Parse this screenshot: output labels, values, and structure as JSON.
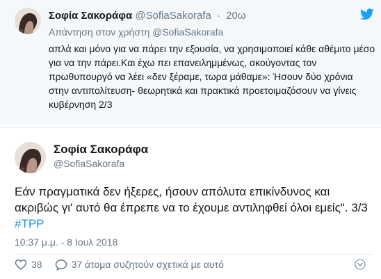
{
  "reply_tweet": {
    "name": "Σοφία Σακοράφα",
    "handle": "@SofiaSakorafa",
    "time": "20ω",
    "replying_prefix": "Απάντηση στον χρήστη",
    "replying_handle": "@SofiaSakorafa",
    "text": "απλά και μόνο για να πάρει την εξουσία, να χρησιμοποιεί κάθε αθέμιτο μέσο για να την πάρει.Και έχω πει επανειλημμένως, ακούγοντας τον πρωθυπουργό να λέει «δεν ξέραμε, τωρα μάθαμε»: Ήσουν δύο χρόνια στην αντιπολίτευση- θεωρητικά και πρακτικά προετοιμαζόσουν να γίνεις κυβέρνηση 2/3"
  },
  "main_tweet": {
    "name": "Σοφία Σακοράφα",
    "handle": "@SofiaSakorafa",
    "text": "Εάν πραγματικά δεν ήξερες, ήσουν απόλυτα επικίνδυνος και ακριβώς γι' αυτό θα έπρεπε να το έχουμε αντιληφθεί όλοι εμείς\". 3/3",
    "hashtag": "#TPP",
    "timestamp": "10:37 μ.μ. - 8 Ιουλ 2018",
    "like_count": "38",
    "reply_label": "37 άτομα συζητούν σχετικά με αυτό"
  },
  "icons": {
    "twitter": "twitter-bird-icon",
    "like": "heart-icon",
    "reply": "speech-bubble-icon",
    "more": "chevron-down-circle-icon"
  },
  "colors": {
    "brand": "#1da1f2",
    "link": "#1b95e0",
    "muted": "#657786",
    "reply_bg": "#f5f8fa"
  }
}
